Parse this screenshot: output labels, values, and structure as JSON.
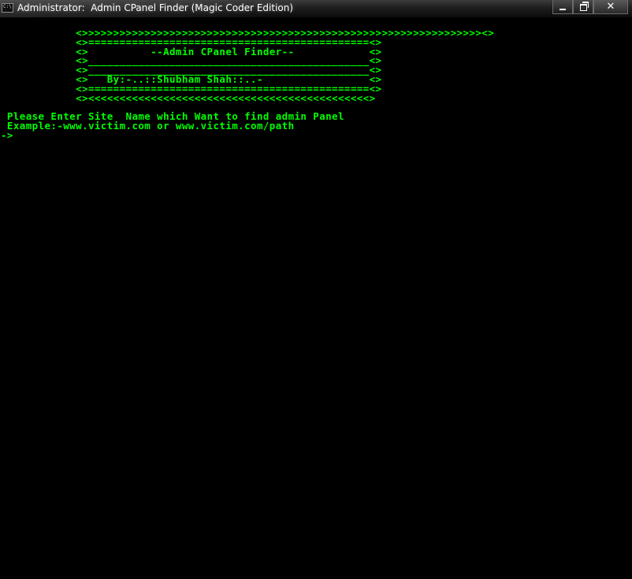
{
  "window": {
    "title": "Administrator:  Admin CPanel Finder (Magic Coder Edition)",
    "icon": "console-icon",
    "icon_text": "C:\\",
    "buttons": {
      "minimize": "minimize-icon",
      "maximize": "restore-icon",
      "close_glyph": "✕"
    }
  },
  "console": {
    "text_color": "#00ff00",
    "background": "#000000",
    "banner": [
      "            <>>>>>>>>>>>>>>>>>>>>>>>>>>>>>>>>>>>>>>>>>>>>>>>>>>>>>>>>>>>>>>>><>",
      "            <>=============================================<>",
      "            <>          --Admin CPanel Finder--            <>",
      "            <>_____________________________________________<>",
      "            <>_____________________________________________<>",
      "            <>   By:-..::Shubham Shah::..-                 <>",
      "            <>=============================================<>",
      "            <><<<<<<<<<<<<<<<<<<<<<<<<<<<<<<<<<<<<<<<<<<<<<>"
    ],
    "blank": "",
    "prompt_line": " Please Enter Site  Name which Want to find admin Panel",
    "example_line": " Example:-www.victim.com or www.victim.com/path",
    "input_prompt": "->"
  }
}
